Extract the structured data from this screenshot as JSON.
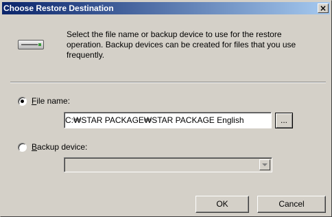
{
  "window": {
    "title": "Choose Restore Destination",
    "close_glyph": "×"
  },
  "description": "Select the file name or backup device to use for the restore operation.  Backup devices can be created for files that you use frequently.",
  "icon": "backup-device-icon",
  "file_name": {
    "label_accel": "F",
    "label_rest": "ile name:",
    "checked": true,
    "value": "C:₩STAR PACKAGE₩STAR PACKAGE English",
    "browse_label": "..."
  },
  "backup_device": {
    "label_accel": "B",
    "label_rest": "ackup device:",
    "checked": false,
    "selected": "",
    "enabled": false
  },
  "buttons": {
    "ok": "OK",
    "cancel": "Cancel"
  },
  "colors": {
    "dialog_face": "#d4d0c8",
    "titlebar_start": "#0a246a",
    "titlebar_end": "#a6caf0"
  }
}
